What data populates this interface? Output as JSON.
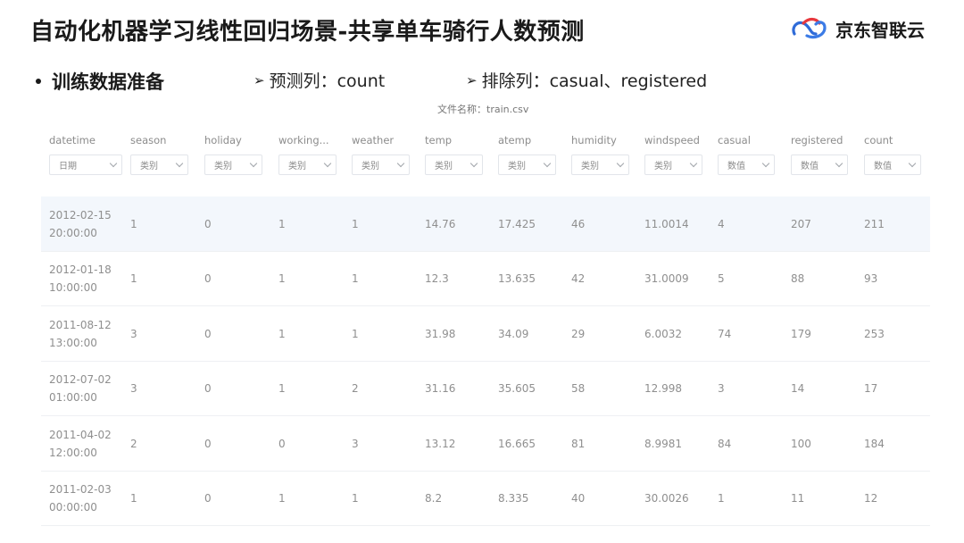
{
  "slide": {
    "title": "自动化机器学习线性回归场景-共享单车骑行人数预测",
    "logo_text": "京东智联云",
    "bullet": "训练数据准备",
    "note1": "预测列：count",
    "note2": "排除列：casual、registered",
    "filename": "文件名称：train.csv",
    "brand_colors": {
      "logo_red": "#e8383d",
      "logo_blue": "#2f6bd8"
    }
  },
  "table": {
    "columns": [
      {
        "name": "datetime",
        "type": "日期"
      },
      {
        "name": "season",
        "type": "类别"
      },
      {
        "name": "holiday",
        "type": "类别"
      },
      {
        "name": "working...",
        "type": "类别"
      },
      {
        "name": "weather",
        "type": "类别"
      },
      {
        "name": "temp",
        "type": "类别"
      },
      {
        "name": "atemp",
        "type": "类别"
      },
      {
        "name": "humidity",
        "type": "类别"
      },
      {
        "name": "windspeed",
        "type": "类别"
      },
      {
        "name": "casual",
        "type": "数值"
      },
      {
        "name": "registered",
        "type": "数值"
      },
      {
        "name": "count",
        "type": "数值"
      }
    ],
    "rows": [
      [
        "2012-02-15 20:00:00",
        "1",
        "0",
        "1",
        "1",
        "14.76",
        "17.425",
        "46",
        "11.0014",
        "4",
        "207",
        "211"
      ],
      [
        "2012-01-18 10:00:00",
        "1",
        "0",
        "1",
        "1",
        "12.3",
        "13.635",
        "42",
        "31.0009",
        "5",
        "88",
        "93"
      ],
      [
        "2011-08-12 13:00:00",
        "3",
        "0",
        "1",
        "1",
        "31.98",
        "34.09",
        "29",
        "6.0032",
        "74",
        "179",
        "253"
      ],
      [
        "2012-07-02 01:00:00",
        "3",
        "0",
        "1",
        "2",
        "31.16",
        "35.605",
        "58",
        "12.998",
        "3",
        "14",
        "17"
      ],
      [
        "2011-04-02 12:00:00",
        "2",
        "0",
        "0",
        "3",
        "13.12",
        "16.665",
        "81",
        "8.9981",
        "84",
        "100",
        "184"
      ],
      [
        "2011-02-03 00:00:00",
        "1",
        "0",
        "1",
        "1",
        "8.2",
        "8.335",
        "40",
        "30.0026",
        "1",
        "11",
        "12"
      ]
    ]
  }
}
